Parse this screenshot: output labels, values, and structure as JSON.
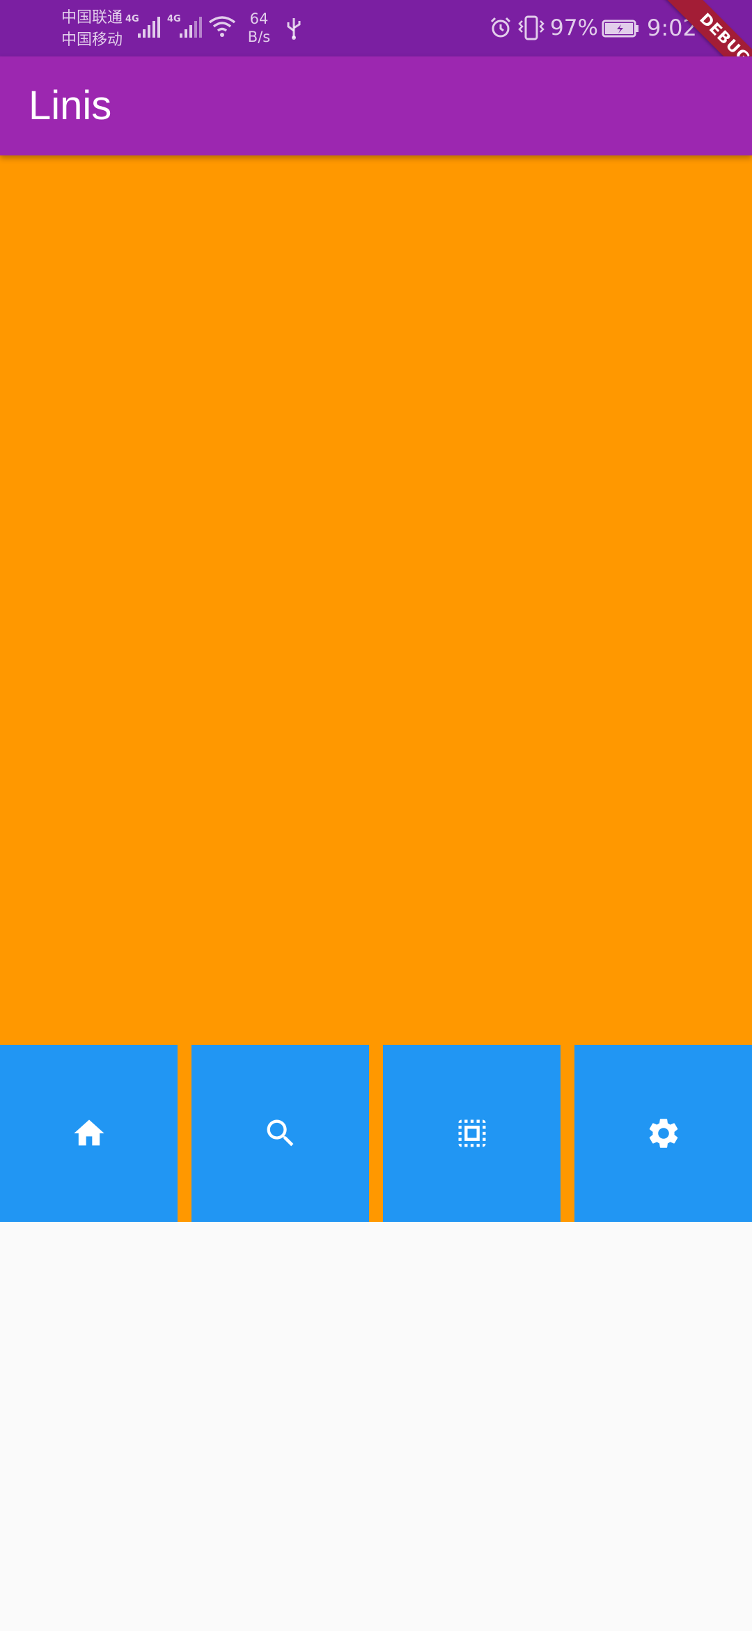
{
  "status_bar": {
    "carrier_1": "中国联通",
    "carrier_2": "中国移动",
    "network_type_1": "4G",
    "network_type_2": "4G",
    "net_speed_value": "64",
    "net_speed_unit": "B/s",
    "battery_percent": "97%",
    "time": "9:02"
  },
  "debug_banner": "DEBUG",
  "app_bar": {
    "title": "Linis"
  },
  "tiles": [
    {
      "icon": "home-icon"
    },
    {
      "icon": "search-icon"
    },
    {
      "icon": "select-all-icon"
    },
    {
      "icon": "settings-icon"
    }
  ],
  "colors": {
    "status_bar": "#7b1fa2",
    "app_bar": "#9c27b0",
    "body_accent": "#ff9800",
    "tile": "#2196f3",
    "background": "#fafafa",
    "debug_ribbon": "#a31d36"
  }
}
